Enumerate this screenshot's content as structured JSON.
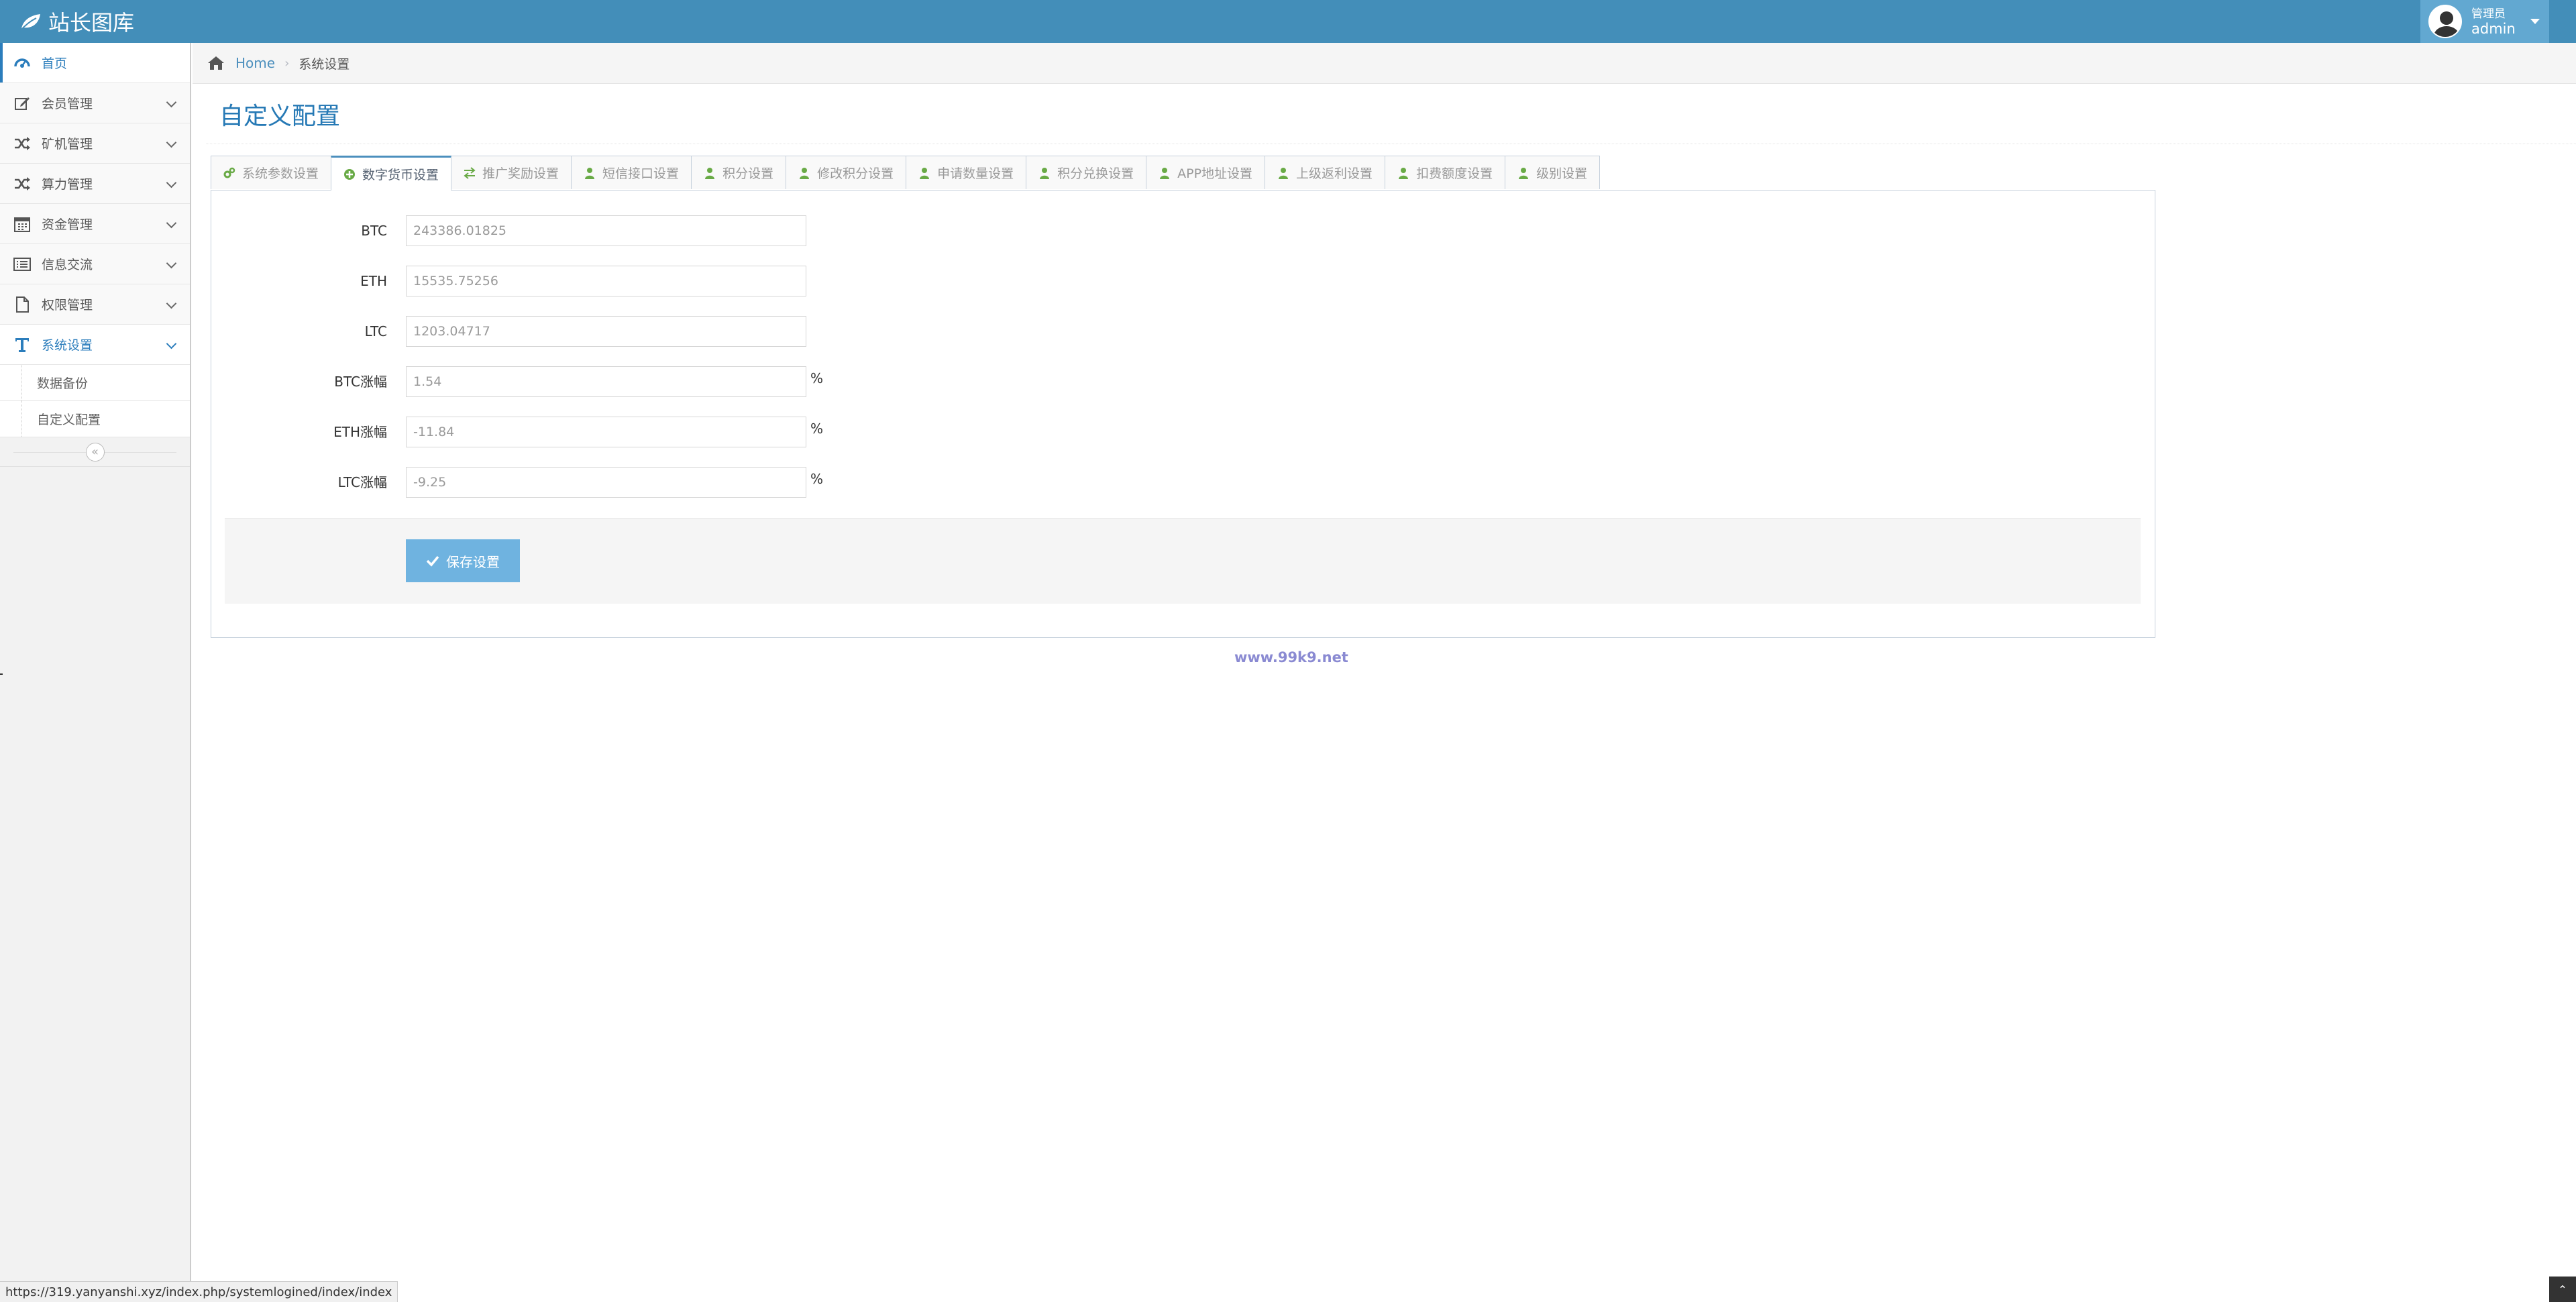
{
  "app": {
    "brand": "站长图库"
  },
  "user": {
    "role": "管理员",
    "name": "admin"
  },
  "sidebar": {
    "items": [
      {
        "label": "首页",
        "icon": "dashboard-icon",
        "state": "active"
      },
      {
        "label": "会员管理",
        "icon": "edit-icon"
      },
      {
        "label": "矿机管理",
        "icon": "random-icon"
      },
      {
        "label": "算力管理",
        "icon": "random-icon"
      },
      {
        "label": "资金管理",
        "icon": "calendar-icon"
      },
      {
        "label": "信息交流",
        "icon": "list-alt-icon"
      },
      {
        "label": "权限管理",
        "icon": "file-icon"
      },
      {
        "label": "系统设置",
        "icon": "text-icon",
        "state": "open"
      }
    ],
    "subitems": [
      {
        "label": "数据备份"
      },
      {
        "label": "自定义配置"
      }
    ],
    "collapse_symbol": "«"
  },
  "breadcrumb": {
    "home": "Home",
    "separator": "›",
    "current": "系统设置"
  },
  "page": {
    "title": "自定义配置"
  },
  "tabs": [
    {
      "label": "系统参数设置",
      "icon": "cogs-icon"
    },
    {
      "label": "数字货币设置",
      "icon": "plus-circle-icon",
      "active": true
    },
    {
      "label": "推广奖励设置",
      "icon": "exchange-icon"
    },
    {
      "label": "短信接口设置",
      "icon": "user-icon"
    },
    {
      "label": "积分设置",
      "icon": "user-icon"
    },
    {
      "label": "修改积分设置",
      "icon": "user-icon"
    },
    {
      "label": "申请数量设置",
      "icon": "user-icon"
    },
    {
      "label": "积分兑换设置",
      "icon": "user-icon"
    },
    {
      "label": "APP地址设置",
      "icon": "user-icon"
    },
    {
      "label": "上级返利设置",
      "icon": "user-icon"
    },
    {
      "label": "扣费额度设置",
      "icon": "user-icon"
    },
    {
      "label": "级别设置",
      "icon": "user-icon"
    }
  ],
  "form": {
    "fields": [
      {
        "label": "BTC",
        "value": "243386.01825",
        "unit": ""
      },
      {
        "label": "ETH",
        "value": "15535.75256",
        "unit": ""
      },
      {
        "label": "LTC",
        "value": "1203.04717",
        "unit": ""
      },
      {
        "label": "BTC涨幅",
        "value": "1.54",
        "unit": "%"
      },
      {
        "label": "ETH涨幅",
        "value": "-11.84",
        "unit": "%"
      },
      {
        "label": "LTC涨幅",
        "value": "-9.25",
        "unit": "%"
      }
    ],
    "save_label": "保存设置"
  },
  "footer": {
    "link": "www.99k9.net"
  },
  "status_bar": {
    "url": "https://319.yanyanshi.xyz/index.php/systemlogined/index/index"
  },
  "colors": {
    "navbar": "#438eb9",
    "accent": "#2679b5",
    "save_button": "#6fb3e0",
    "tab_icon_green": "#69aa46"
  }
}
